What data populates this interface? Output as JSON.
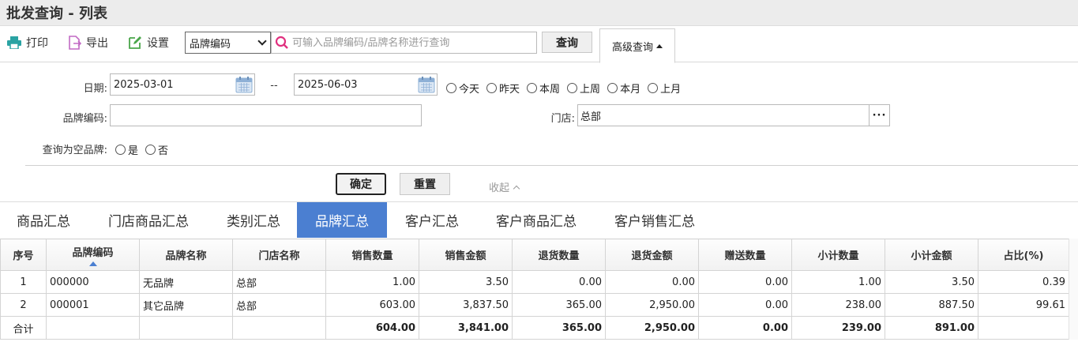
{
  "title": "批发查询 - 列表",
  "toolbar": {
    "print_label": "打印",
    "export_label": "导出",
    "settings_label": "设置",
    "field_select_value": "品牌编码",
    "search_placeholder": "可输入品牌编码/品牌名称进行查询",
    "query_label": "查询",
    "advanced_label": "高级查询"
  },
  "filter": {
    "date_label": "日期:",
    "date_from": "2025-03-01",
    "date_sep": "--",
    "date_to": "2025-06-03",
    "quick_ranges": [
      "今天",
      "昨天",
      "本周",
      "上周",
      "本月",
      "上月"
    ],
    "brand_code_label": "品牌编码:",
    "brand_code_value": "",
    "store_label": "门店:",
    "store_value": "总部",
    "store_picker": "···",
    "empty_brand_label": "查询为空品牌:",
    "empty_brand_options": [
      "是",
      "否"
    ],
    "confirm_label": "确定",
    "reset_label": "重置",
    "collapse_label": "收起"
  },
  "tabs": [
    {
      "label": "商品汇总",
      "active": false
    },
    {
      "label": "门店商品汇总",
      "active": false
    },
    {
      "label": "类别汇总",
      "active": false
    },
    {
      "label": "品牌汇总",
      "active": true
    },
    {
      "label": "客户汇总",
      "active": false
    },
    {
      "label": "客户商品汇总",
      "active": false
    },
    {
      "label": "客户销售汇总",
      "active": false
    }
  ],
  "table": {
    "columns": [
      "序号",
      "品牌编码",
      "品牌名称",
      "门店名称",
      "销售数量",
      "销售金额",
      "退货数量",
      "退货金额",
      "赠送数量",
      "小计数量",
      "小计金额",
      "占比(%)"
    ],
    "rows": [
      [
        "1",
        "000000",
        "无品牌",
        "总部",
        "1.00",
        "3.50",
        "0.00",
        "0.00",
        "0.00",
        "1.00",
        "3.50",
        "0.39"
      ],
      [
        "2",
        "000001",
        "其它品牌",
        "总部",
        "603.00",
        "3,837.50",
        "365.00",
        "2,950.00",
        "0.00",
        "238.00",
        "887.50",
        "99.61"
      ]
    ],
    "total": [
      "合计",
      "",
      "",
      "",
      "604.00",
      "3,841.00",
      "365.00",
      "2,950.00",
      "0.00",
      "239.00",
      "891.00",
      ""
    ]
  },
  "colors": {
    "accent": "#4b7fd1",
    "print_icon": "#2aa3a3",
    "export_icon": "#c26ac4",
    "settings_icon": "#4aa64a",
    "search_icon": "#e0307f",
    "calendar_icon": "#8eb0d6"
  }
}
